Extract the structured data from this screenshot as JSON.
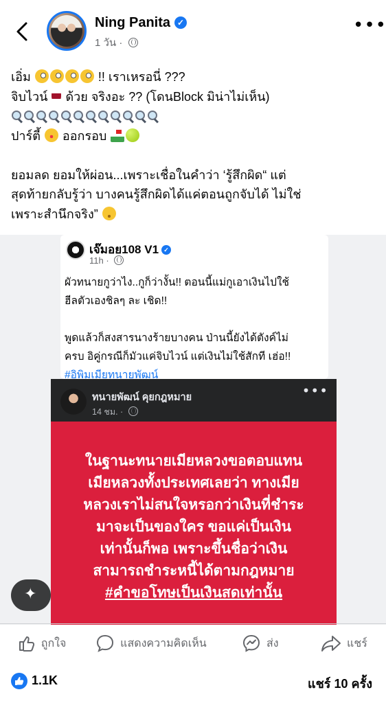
{
  "post": {
    "author": "Ning Panita",
    "time": "1 วัน",
    "caption_lines": [
      "เอิ่ม",
      "!! เราเหรอนี่ ???",
      "จิบไวน์",
      "ด้วย จริงอะ ?? (โดนBlock มิน่าไม่เห็น)",
      "ปาร์ตี้",
      "ออกรอบ",
      "ยอมลด ยอมให้ผ่อน...เพราะเชื่อในคำว่า ‘รู้สึกผิด“ แต่",
      "สุดท้ายกลับรู้ว่า บางคนรู้สึกผิดได้แค่ตอนถูกจับได้ ไม่ใช่",
      "เพราะสำนึกจริง”"
    ],
    "icons": {
      "back": "back-arrow-icon",
      "verified": "verified-badge-icon",
      "privacy": "globe-icon",
      "more": "more-icon"
    }
  },
  "quote": {
    "author": "เจ๊มอย108 V1",
    "time": "11h",
    "body_1": "ผัวทนายกูว่าไง..กูก็ว่างั้น!! ตอนนี้แม่กูเอาเงินไปใช้\nฮีลตัวเองชิลๆ ละ เชิด!!",
    "body_2": "พูดแล้วก็สงสารนางร้ายบางคน ป่านนี้ยังได้ตังค์ไม่\nครบ อิคู่กรณีก็มัวแค่จิบไวน์ แต่เงินไม่ใช้สักที เฮ่อ!!",
    "hashtag": "#อิพิมเมียทนายพัฒน์"
  },
  "embedded": {
    "author": "ทนายพัฒน์ คุยกฎหมาย",
    "time": "14 ชม.",
    "text": "ในฐานะทนายเมียหลวงขอตอบแทน\nเมียหลวงทั้งประเทศเลยว่า ทางเมีย\nหลวงเราไม่สนใจหรอกว่าเงินที่ชำระ\nมาจะเป็นของใคร ขอแค่เป็นเงิน\nเท่านั้นก็พอ เพราะขึ้นชื่อว่าเงิน\nสามารถชำระหนี้ได้ตามกฎหมาย",
    "hashtag": "#คำขอโทษเป็นเงินสดเท่านั้น",
    "bg_color": "#db1f3d"
  },
  "actions": {
    "like": "ถูกใจ",
    "comment": "แสดงความคิดเห็น",
    "send": "ส่ง",
    "share": "แชร์"
  },
  "stats": {
    "likes": "1.1K",
    "shares": "แชร์ 10 ครั้ง"
  },
  "colors": {
    "accent": "#1877f2",
    "muted": "#65676b"
  }
}
